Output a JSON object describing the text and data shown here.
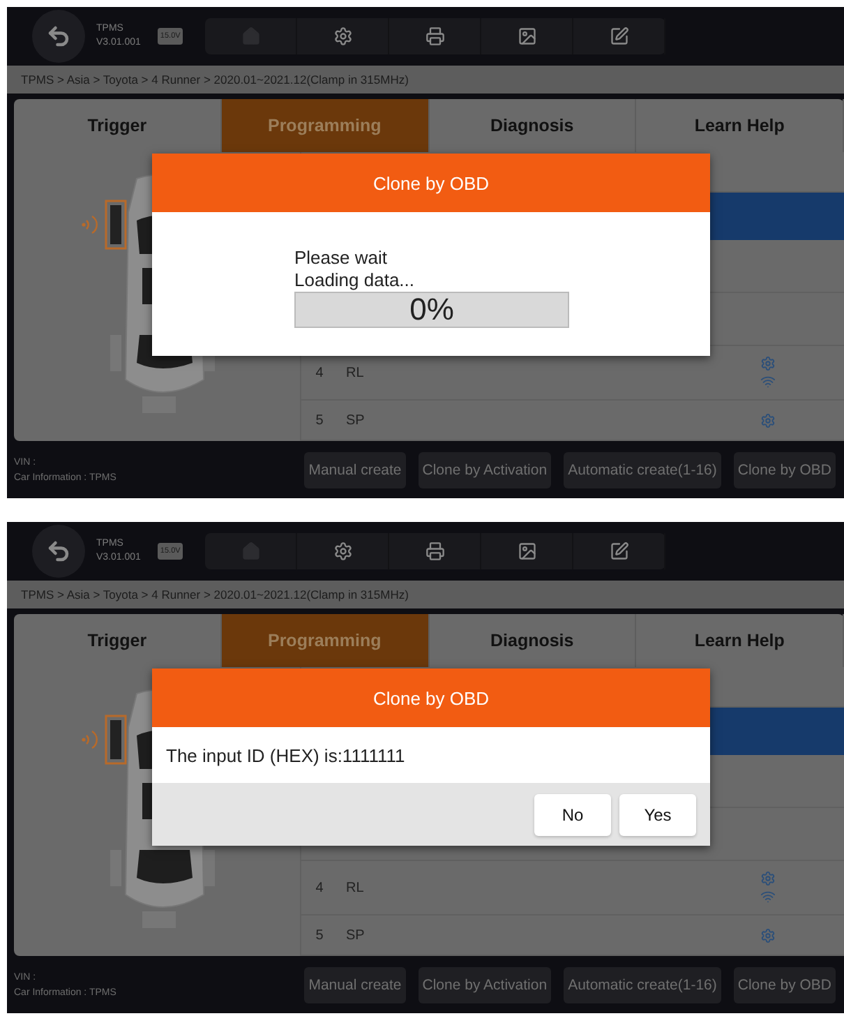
{
  "screens": [
    {
      "header": {
        "app": "TPMS",
        "version": "V3.01.001",
        "battery": "15.0V"
      },
      "breadcrumb": "TPMS > Asia > Toyota > 4 Runner > 2020.01~2021.12(Clamp in 315MHz)",
      "tabs": [
        {
          "label": "Trigger",
          "selected": false
        },
        {
          "label": "Programming",
          "selected": true
        },
        {
          "label": "Diagnosis",
          "selected": false
        },
        {
          "label": "Learn Help",
          "selected": false
        }
      ],
      "table_rows": [
        {
          "number": "4",
          "position": "RL",
          "wifi": true
        },
        {
          "number": "5",
          "position": "SP",
          "wifi": false
        }
      ],
      "vin": "VIN :",
      "car_info": "Car Information : TPMS",
      "actions": [
        "Manual create",
        "Clone by Activation",
        "Automatic create(1-16)",
        "Clone by OBD"
      ],
      "dialog": {
        "kind": "progress",
        "title": "Clone by OBD",
        "lines": [
          "Please wait",
          "Loading data..."
        ],
        "progress": {
          "level": 0,
          "reading": "0%"
        }
      }
    },
    {
      "header": {
        "app": "TPMS",
        "version": "V3.01.001",
        "battery": "15.0V"
      },
      "breadcrumb": "TPMS > Asia > Toyota > 4 Runner > 2020.01~2021.12(Clamp in 315MHz)",
      "tabs": [
        {
          "label": "Trigger",
          "selected": false
        },
        {
          "label": "Programming",
          "selected": true
        },
        {
          "label": "Diagnosis",
          "selected": false
        },
        {
          "label": "Learn Help",
          "selected": false
        }
      ],
      "table_rows": [
        {
          "number": "4",
          "position": "RL",
          "wifi": true
        },
        {
          "number": "5",
          "position": "SP",
          "wifi": false
        }
      ],
      "vin": "VIN :",
      "car_info": "Car Information : TPMS",
      "actions": [
        "Manual create",
        "Clone by Activation",
        "Automatic create(1-16)",
        "Clone by OBD"
      ],
      "dialog": {
        "kind": "confirm",
        "title": "Clone by OBD",
        "message": "The input ID (HEX) is:1111111",
        "buttons": [
          "No",
          "Yes"
        ]
      }
    }
  ]
}
